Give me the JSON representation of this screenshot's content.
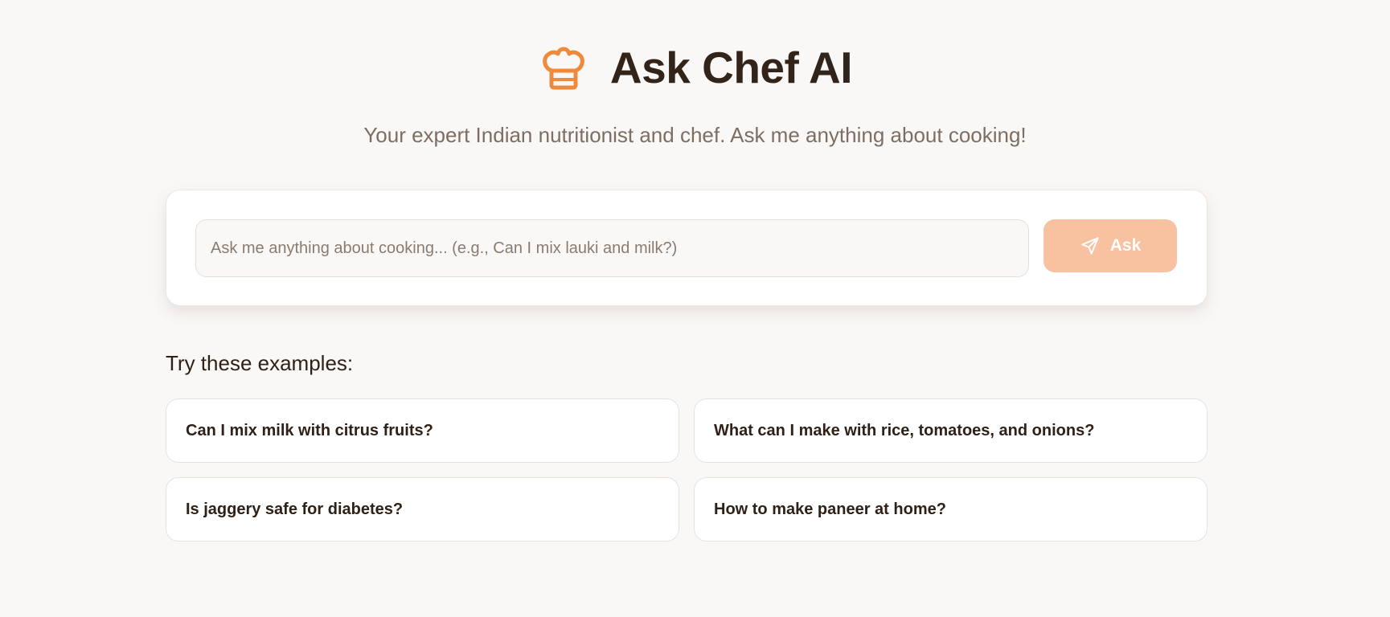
{
  "header": {
    "title": "Ask Chef AI",
    "icon": "chef-hat-icon",
    "subtitle": "Your expert Indian nutritionist and chef. Ask me anything about cooking!"
  },
  "search": {
    "value": "",
    "placeholder": "Ask me anything about cooking... (e.g., Can I mix lauki and milk?)",
    "button_label": "Ask",
    "button_icon": "send-icon"
  },
  "examples": {
    "heading": "Try these examples:",
    "items": [
      "Can I mix milk with citrus fruits?",
      "What can I make with rice, tomatoes, and onions?",
      "Is jaggery safe for diabetes?",
      "How to make paneer at home?"
    ]
  },
  "colors": {
    "accent": "#f08a3b",
    "button_bg": "#f8c19f",
    "background": "#faf8f6",
    "title_text": "#33241a",
    "subtitle_text": "#7d6d63"
  }
}
